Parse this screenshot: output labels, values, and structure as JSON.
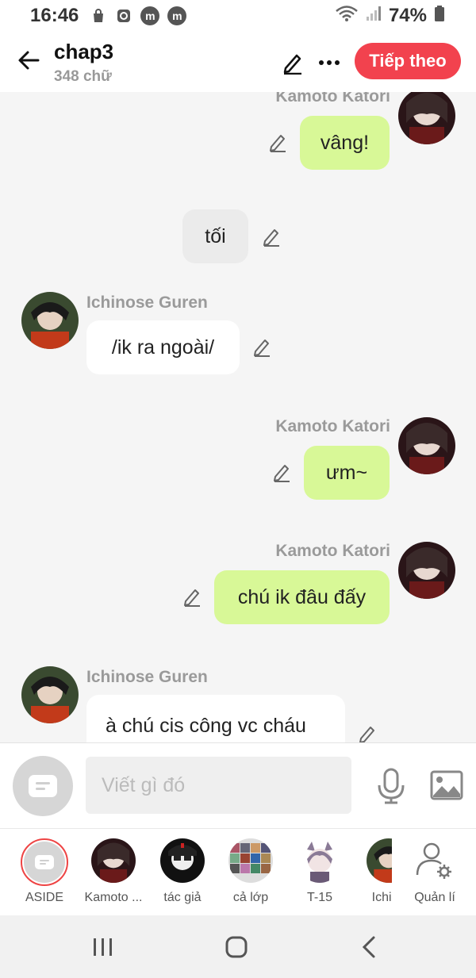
{
  "status_bar": {
    "time": "16:46",
    "battery": "74%",
    "icons": [
      "shopping-bag-icon",
      "clock-app-icon",
      "m-app-icon",
      "m-app-icon",
      "wifi-icon",
      "signal-icon",
      "battery-icon"
    ],
    "app_icon_letter": "m"
  },
  "header": {
    "title": "chap3",
    "word_count": "348 chữ",
    "next_label": "Tiếp theo",
    "accent_color": "#f2424e"
  },
  "messages": [
    {
      "sender": "Kamoto Katori",
      "text": "vâng!",
      "side": "right",
      "style": "green"
    },
    {
      "sender": "",
      "text": "tối",
      "side": "center",
      "style": "grey"
    },
    {
      "sender": "Ichinose Guren",
      "text": "/ik ra ngoài/",
      "side": "left",
      "style": "white"
    },
    {
      "sender": "Kamoto Katori",
      "text": "ưm~",
      "side": "right",
      "style": "green"
    },
    {
      "sender": "Kamoto Katori",
      "text": "chú ik đâu đấy",
      "side": "right",
      "style": "green"
    },
    {
      "sender": "Ichinose Guren",
      "text": "à chú cis công vc cháu",
      "side": "left",
      "style": "white"
    }
  ],
  "composer": {
    "placeholder": "Viết gì đó"
  },
  "characters": [
    {
      "label": "ASIDE"
    },
    {
      "label": "Kamoto ..."
    },
    {
      "label": "tác giả"
    },
    {
      "label": "cả lớp"
    },
    {
      "label": "T-15"
    },
    {
      "label": "Ichino"
    },
    {
      "label": "Quản lí"
    }
  ],
  "colors": {
    "green_bubble": "#d8f897",
    "sender_gray": "#9a9a9a",
    "chat_bg": "#f5f5f5"
  }
}
